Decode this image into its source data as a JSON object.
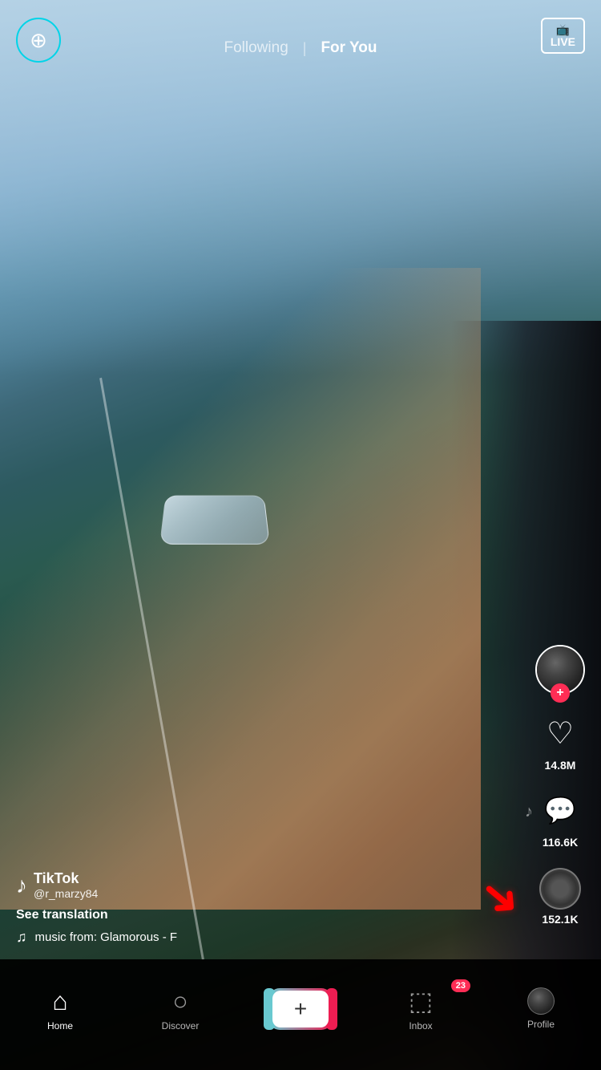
{
  "app": {
    "title": "TikTok"
  },
  "header": {
    "camera_label": "📷",
    "following_label": "Following",
    "for_you_label": "For You",
    "live_label": "LIVE",
    "active_tab": "for_you"
  },
  "video": {
    "creator": "TikTok",
    "username": "@r_marzy84",
    "see_translation": "See translation",
    "music_info": "music from: Glamorous - F"
  },
  "actions": {
    "likes": "14.8M",
    "comments": "116.6K",
    "shares": "152.1K"
  },
  "bottom_nav": {
    "home_label": "Home",
    "discover_label": "Discover",
    "create_label": "+",
    "inbox_label": "Inbox",
    "inbox_badge": "23",
    "profile_label": "Profile"
  }
}
